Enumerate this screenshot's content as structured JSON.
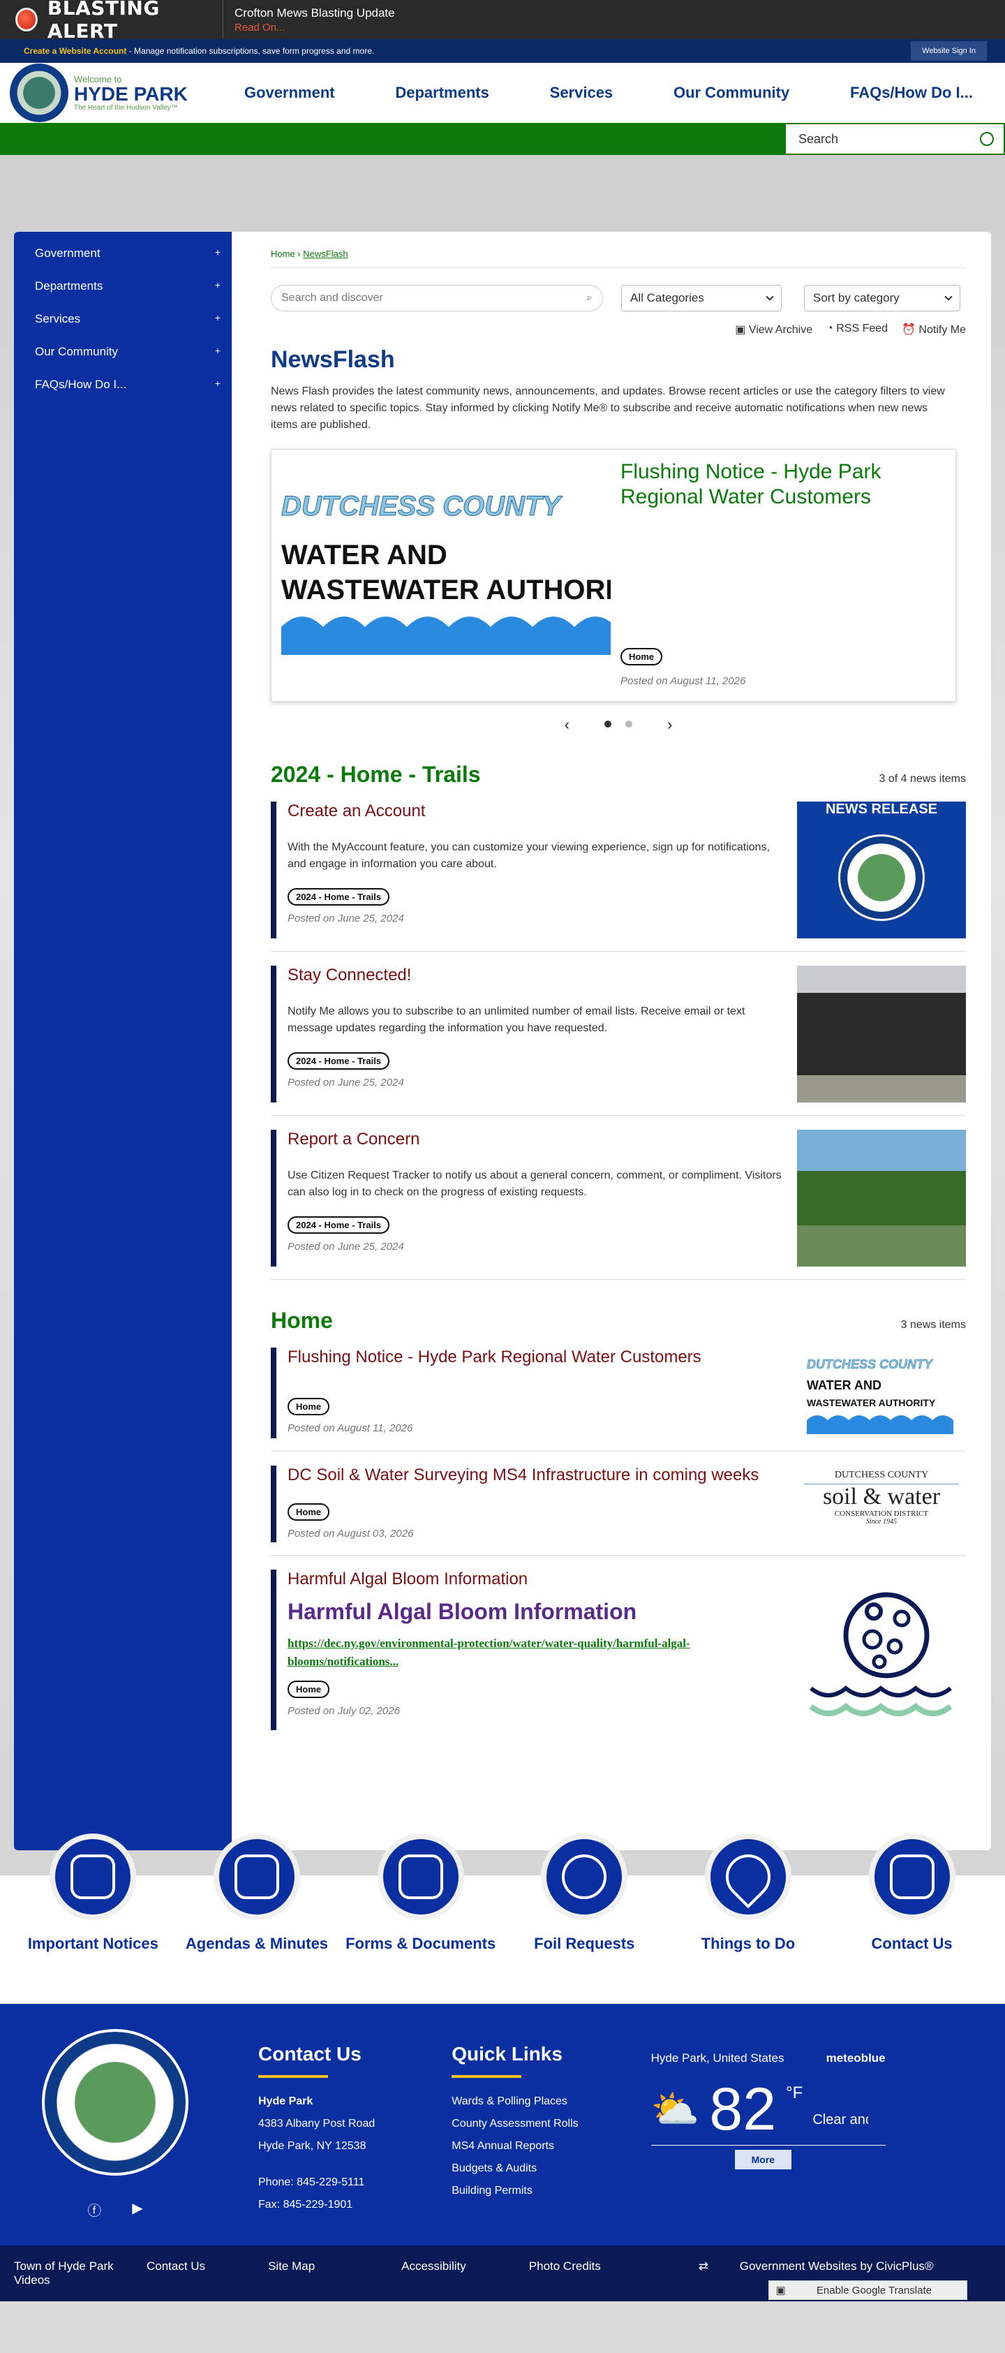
{
  "alert": {
    "title": "BLASTING ALERT",
    "message": "Crofton Mews Blasting Update",
    "read_on": "Read On..."
  },
  "account": {
    "create": "Create a Website Account",
    "desc": " - Manage notification subscriptions, save form progress and more.",
    "signin": "Website Sign In"
  },
  "logo": {
    "welcome": "Welcome to",
    "name": "HYDE PARK",
    "tagline": "The Heart of the Hudson Valley™"
  },
  "nav": [
    "Government",
    "Departments",
    "Services",
    "Our Community",
    "FAQs/How Do I..."
  ],
  "search": {
    "placeholder": "Search"
  },
  "sidebar": [
    "Government",
    "Departments",
    "Services",
    "Our Community",
    "FAQs/How Do I..."
  ],
  "breadcrumb": {
    "home": "Home",
    "current": "NewsFlash"
  },
  "filters": {
    "search_placeholder": "Search and discover",
    "category": "All Categories",
    "sort": "Sort by category"
  },
  "actions": {
    "archive": "View Archive",
    "rss": "RSS Feed",
    "notify": "Notify Me"
  },
  "newsflash": {
    "title": "NewsFlash",
    "desc": "News Flash provides the latest community news, announcements, and updates. Browse recent articles or use the category filters to view news related to specific topics. Stay informed by clicking Notify Me® to subscribe and receive automatic notifications when new news items are published."
  },
  "featured": {
    "img_line1": "DUTCHESS COUNTY",
    "img_line2": "WATER AND",
    "img_line3": "WASTEWATER AUTHORITY",
    "title": "Flushing Notice - Hyde Park Regional Water Customers",
    "tag": "Home",
    "posted": "Posted on August 11, 2026"
  },
  "section1": {
    "title": "2024 - Home - Trails",
    "count": "3 of 4 news items",
    "items": [
      {
        "title": "Create an Account",
        "text": "With the MyAccount feature, you can customize your viewing experience, sign up for notifications, and engage in information you care about.",
        "tag": "2024 - Home - Trails",
        "posted": "Posted on June 25, 2024",
        "thumb": "NEWS RELEASE"
      },
      {
        "title": "Stay Connected!",
        "text": "Notify Me allows you to subscribe to an unlimited number of email lists. Receive email or text message updates regarding the information you have requested.",
        "tag": "2024 - Home - Trails",
        "posted": "Posted on June 25, 2024"
      },
      {
        "title": "Report a Concern",
        "text": "Use Citizen Request Tracker to notify us about a general concern, comment, or compliment. Visitors can also log in to check on the progress of existing requests.",
        "tag": "2024 - Home - Trails",
        "posted": "Posted on June 25, 2024"
      }
    ]
  },
  "section2": {
    "title": "Home",
    "count": "3 news items",
    "items": [
      {
        "title": "Flushing Notice - Hyde Park Regional Water Customers",
        "tag": "Home",
        "posted": "Posted on August 11, 2026",
        "img1": "DUTCHESS COUNTY",
        "img2": "WATER AND",
        "img3": "WASTEWATER AUTHORITY"
      },
      {
        "title": "DC Soil & Water Surveying MS4 Infrastructure in coming weeks",
        "tag": "Home",
        "posted": "Posted on August 03, 2026",
        "img1": "DUTCHESS COUNTY",
        "img2": "soil & water",
        "img3": "CONSERVATION DISTRICT",
        "img4": "Since 1945"
      },
      {
        "title": "Harmful Algal Bloom Information",
        "subtitle": "Harmful Algal Bloom Information",
        "link": "https://dec.ny.gov/environmental-protection/water/water-quality/harmful-algal-blooms/notifications",
        "ellipsis": "...",
        "tag": "Home",
        "posted": "Posted on July 02, 2026"
      }
    ]
  },
  "quick_links": [
    "Important Notices",
    "Agendas & Minutes",
    "Forms & Documents",
    "Foil Requests",
    "Things to Do",
    "Contact Us"
  ],
  "footer": {
    "contact_title": "Contact Us",
    "name": "Hyde Park",
    "addr1": "4383 Albany Post Road",
    "addr2": "Hyde Park, NY 12538",
    "phone": "Phone: 845-229-5111",
    "fax": "Fax: 845-229-1901",
    "links_title": "Quick Links",
    "links": [
      "Wards & Polling Places",
      "County Assessment Rolls",
      "MS4 Annual Reports",
      "Budgets & Audits",
      "Building Permits"
    ],
    "weather": {
      "location": "Hyde Park, United States",
      "brand": "meteoblue",
      "temp": "82",
      "unit": "°F",
      "cond": "Clear and f",
      "more": "More"
    }
  },
  "bottom": {
    "items": [
      "Town of Hyde Park Videos",
      "Contact Us",
      "Site Map",
      "Accessibility",
      "Photo Credits"
    ],
    "civic": "Government Websites by CivicPlus®",
    "translate": "Enable Google Translate"
  },
  "colors": {
    "navy": "#0a2fa0",
    "green": "#0a7a0a",
    "maroon": "#7a1010"
  }
}
